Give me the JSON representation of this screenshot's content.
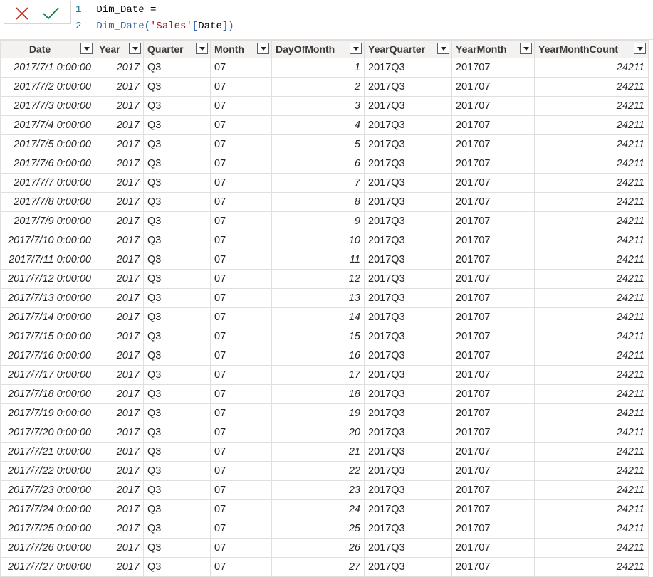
{
  "formula": {
    "cancel_icon": "close-x-icon",
    "commit_icon": "check-icon",
    "colors": {
      "cancel": "#c42b1c",
      "commit": "#107c41"
    },
    "line1": {
      "number": "1",
      "text": "Dim_Date ="
    },
    "line2": {
      "number": "2",
      "func": "Dim_Date(",
      "table": "'Sales'",
      "open_bracket": "[",
      "column": "Date",
      "close_bracket": "]",
      "close_paren": ")"
    }
  },
  "grid": {
    "columns": [
      "Date",
      "Year",
      "Quarter",
      "Month",
      "DayOfMonth",
      "YearQuarter",
      "YearMonth",
      "YearMonthCount"
    ],
    "filter_icon": "dropdown-filter-icon",
    "rows": [
      [
        "2017/7/1 0:00:00",
        "2017",
        "Q3",
        "07",
        "1",
        "2017Q3",
        "201707",
        "24211"
      ],
      [
        "2017/7/2 0:00:00",
        "2017",
        "Q3",
        "07",
        "2",
        "2017Q3",
        "201707",
        "24211"
      ],
      [
        "2017/7/3 0:00:00",
        "2017",
        "Q3",
        "07",
        "3",
        "2017Q3",
        "201707",
        "24211"
      ],
      [
        "2017/7/4 0:00:00",
        "2017",
        "Q3",
        "07",
        "4",
        "2017Q3",
        "201707",
        "24211"
      ],
      [
        "2017/7/5 0:00:00",
        "2017",
        "Q3",
        "07",
        "5",
        "2017Q3",
        "201707",
        "24211"
      ],
      [
        "2017/7/6 0:00:00",
        "2017",
        "Q3",
        "07",
        "6",
        "2017Q3",
        "201707",
        "24211"
      ],
      [
        "2017/7/7 0:00:00",
        "2017",
        "Q3",
        "07",
        "7",
        "2017Q3",
        "201707",
        "24211"
      ],
      [
        "2017/7/8 0:00:00",
        "2017",
        "Q3",
        "07",
        "8",
        "2017Q3",
        "201707",
        "24211"
      ],
      [
        "2017/7/9 0:00:00",
        "2017",
        "Q3",
        "07",
        "9",
        "2017Q3",
        "201707",
        "24211"
      ],
      [
        "2017/7/10 0:00:00",
        "2017",
        "Q3",
        "07",
        "10",
        "2017Q3",
        "201707",
        "24211"
      ],
      [
        "2017/7/11 0:00:00",
        "2017",
        "Q3",
        "07",
        "11",
        "2017Q3",
        "201707",
        "24211"
      ],
      [
        "2017/7/12 0:00:00",
        "2017",
        "Q3",
        "07",
        "12",
        "2017Q3",
        "201707",
        "24211"
      ],
      [
        "2017/7/13 0:00:00",
        "2017",
        "Q3",
        "07",
        "13",
        "2017Q3",
        "201707",
        "24211"
      ],
      [
        "2017/7/14 0:00:00",
        "2017",
        "Q3",
        "07",
        "14",
        "2017Q3",
        "201707",
        "24211"
      ],
      [
        "2017/7/15 0:00:00",
        "2017",
        "Q3",
        "07",
        "15",
        "2017Q3",
        "201707",
        "24211"
      ],
      [
        "2017/7/16 0:00:00",
        "2017",
        "Q3",
        "07",
        "16",
        "2017Q3",
        "201707",
        "24211"
      ],
      [
        "2017/7/17 0:00:00",
        "2017",
        "Q3",
        "07",
        "17",
        "2017Q3",
        "201707",
        "24211"
      ],
      [
        "2017/7/18 0:00:00",
        "2017",
        "Q3",
        "07",
        "18",
        "2017Q3",
        "201707",
        "24211"
      ],
      [
        "2017/7/19 0:00:00",
        "2017",
        "Q3",
        "07",
        "19",
        "2017Q3",
        "201707",
        "24211"
      ],
      [
        "2017/7/20 0:00:00",
        "2017",
        "Q3",
        "07",
        "20",
        "2017Q3",
        "201707",
        "24211"
      ],
      [
        "2017/7/21 0:00:00",
        "2017",
        "Q3",
        "07",
        "21",
        "2017Q3",
        "201707",
        "24211"
      ],
      [
        "2017/7/22 0:00:00",
        "2017",
        "Q3",
        "07",
        "22",
        "2017Q3",
        "201707",
        "24211"
      ],
      [
        "2017/7/23 0:00:00",
        "2017",
        "Q3",
        "07",
        "23",
        "2017Q3",
        "201707",
        "24211"
      ],
      [
        "2017/7/24 0:00:00",
        "2017",
        "Q3",
        "07",
        "24",
        "2017Q3",
        "201707",
        "24211"
      ],
      [
        "2017/7/25 0:00:00",
        "2017",
        "Q3",
        "07",
        "25",
        "2017Q3",
        "201707",
        "24211"
      ],
      [
        "2017/7/26 0:00:00",
        "2017",
        "Q3",
        "07",
        "26",
        "2017Q3",
        "201707",
        "24211"
      ],
      [
        "2017/7/27 0:00:00",
        "2017",
        "Q3",
        "07",
        "27",
        "2017Q3",
        "201707",
        "24211"
      ]
    ]
  }
}
